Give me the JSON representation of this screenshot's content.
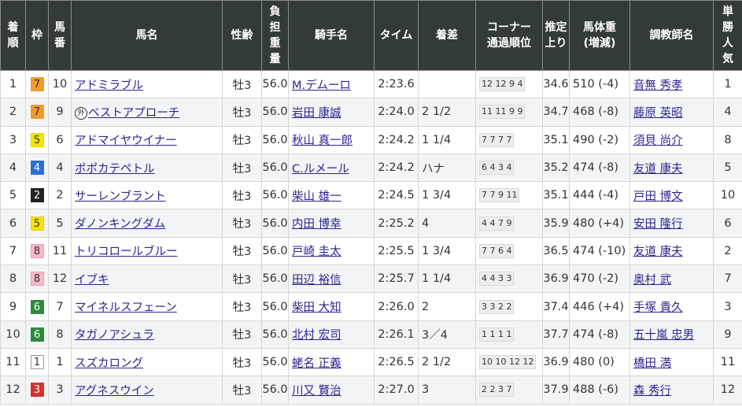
{
  "headers": {
    "rank": "着順",
    "waku": "枠",
    "umaban": "馬番",
    "horse": "馬名",
    "sexage": "性齢",
    "weight": "負担重量",
    "jockey": "騎手名",
    "time": "タイム",
    "margin": "着差",
    "corner": "コーナー\n通過順位",
    "last3f": "推定上り",
    "bodyweight": "馬体重\n(増減)",
    "trainer": "調教師名",
    "popularity": "単勝人気"
  },
  "waku_colors": {
    "1": {
      "bg": "#ffffff",
      "fg": "#333333",
      "border": "#999999"
    },
    "2": {
      "bg": "#222222",
      "fg": "#ffffff",
      "border": "#222222"
    },
    "3": {
      "bg": "#d7322d",
      "fg": "#ffffff",
      "border": "#d7322d"
    },
    "4": {
      "bg": "#2a6fd6",
      "fg": "#ffffff",
      "border": "#2a6fd6"
    },
    "5": {
      "bg": "#f5e400",
      "fg": "#333333",
      "border": "#e5d400"
    },
    "6": {
      "bg": "#2f8a3e",
      "fg": "#ffffff",
      "border": "#2f8a3e"
    },
    "7": {
      "bg": "#f29a2e",
      "fg": "#333333",
      "border": "#f29a2e"
    },
    "8": {
      "bg": "#f6b8c6",
      "fg": "#333333",
      "border": "#e8a0b2"
    }
  },
  "rows": [
    {
      "rank": "1",
      "waku": "7",
      "umaban": "10",
      "horse": "アドミラブル",
      "maru": "",
      "sexage": "牡3",
      "weight": "56.0",
      "jockey": "M.デムーロ",
      "time": "2:23.6",
      "margin": "",
      "corner": "12 12 9 4",
      "last3f": "34.6",
      "bodyweight": "510 (-4)",
      "trainer": "音無 秀孝",
      "popularity": "1"
    },
    {
      "rank": "2",
      "waku": "7",
      "umaban": "9",
      "horse": "ベストアプローチ",
      "maru": "外",
      "sexage": "牡3",
      "weight": "56.0",
      "jockey": "岩田 康誠",
      "time": "2:24.0",
      "margin": "2 1/2",
      "corner": "11 11 9 9",
      "last3f": "34.7",
      "bodyweight": "468 (-8)",
      "trainer": "藤原 英昭",
      "popularity": "4"
    },
    {
      "rank": "3",
      "waku": "5",
      "umaban": "6",
      "horse": "アドマイヤウイナー",
      "maru": "",
      "sexage": "牡3",
      "weight": "56.0",
      "jockey": "秋山 真一郎",
      "time": "2:24.2",
      "margin": "1 1/4",
      "corner": "7 7 7 7",
      "last3f": "35.1",
      "bodyweight": "490 (-2)",
      "trainer": "須貝 尚介",
      "popularity": "8"
    },
    {
      "rank": "4",
      "waku": "4",
      "umaban": "4",
      "horse": "ポポカテペトル",
      "maru": "",
      "sexage": "牡3",
      "weight": "56.0",
      "jockey": "C.ルメール",
      "time": "2:24.2",
      "margin": "ハナ",
      "corner": "6 4 3 4",
      "last3f": "35.2",
      "bodyweight": "474 (-8)",
      "trainer": "友道 康夫",
      "popularity": "5"
    },
    {
      "rank": "5",
      "waku": "2",
      "umaban": "2",
      "horse": "サーレンブラント",
      "maru": "",
      "sexage": "牡3",
      "weight": "56.0",
      "jockey": "柴山 雄一",
      "time": "2:24.5",
      "margin": "1 3/4",
      "corner": "7 7 9 11",
      "last3f": "35.1",
      "bodyweight": "444 (-4)",
      "trainer": "戸田 博文",
      "popularity": "10"
    },
    {
      "rank": "6",
      "waku": "5",
      "umaban": "5",
      "horse": "ダノンキングダム",
      "maru": "",
      "sexage": "牡3",
      "weight": "56.0",
      "jockey": "内田 博幸",
      "time": "2:25.2",
      "margin": "4",
      "corner": "4 4 7 9",
      "last3f": "35.9",
      "bodyweight": "480 (+4)",
      "trainer": "安田 隆行",
      "popularity": "6"
    },
    {
      "rank": "7",
      "waku": "8",
      "umaban": "11",
      "horse": "トリコロールブルー",
      "maru": "",
      "sexage": "牡3",
      "weight": "56.0",
      "jockey": "戸崎 圭太",
      "time": "2:25.5",
      "margin": "1 3/4",
      "corner": "7 7 6 4",
      "last3f": "36.5",
      "bodyweight": "474 (-10)",
      "trainer": "友道 康夫",
      "popularity": "2"
    },
    {
      "rank": "8",
      "waku": "8",
      "umaban": "12",
      "horse": "イブキ",
      "maru": "",
      "sexage": "牡3",
      "weight": "56.0",
      "jockey": "田辺 裕信",
      "time": "2:25.7",
      "margin": "1 1/4",
      "corner": "4 4 3 3",
      "last3f": "36.9",
      "bodyweight": "470 (-2)",
      "trainer": "奥村 武",
      "popularity": "7"
    },
    {
      "rank": "9",
      "waku": "6",
      "umaban": "7",
      "horse": "マイネルスフェーン",
      "maru": "",
      "sexage": "牡3",
      "weight": "56.0",
      "jockey": "柴田 大知",
      "time": "2:26.0",
      "margin": "2",
      "corner": "3 3 2 2",
      "last3f": "37.4",
      "bodyweight": "446 (+4)",
      "trainer": "手塚 貴久",
      "popularity": "3"
    },
    {
      "rank": "10",
      "waku": "6",
      "umaban": "8",
      "horse": "タガノアシュラ",
      "maru": "",
      "sexage": "牡3",
      "weight": "56.0",
      "jockey": "北村 宏司",
      "time": "2:26.1",
      "margin": "3／4",
      "corner": "1 1 1 1",
      "last3f": "37.7",
      "bodyweight": "474 (-8)",
      "trainer": "五十嵐 忠男",
      "popularity": "9"
    },
    {
      "rank": "11",
      "waku": "1",
      "umaban": "1",
      "horse": "スズカロング",
      "maru": "",
      "sexage": "牡3",
      "weight": "56.0",
      "jockey": "蛯名 正義",
      "time": "2:26.5",
      "margin": "2 1/2",
      "corner": "10 10 12 12",
      "last3f": "36.9",
      "bodyweight": "480 (0)",
      "trainer": "橋田 満",
      "popularity": "11"
    },
    {
      "rank": "12",
      "waku": "3",
      "umaban": "3",
      "horse": "アグネスウイン",
      "maru": "",
      "sexage": "牡3",
      "weight": "56.0",
      "jockey": "川又 賢治",
      "time": "2:27.0",
      "margin": "3",
      "corner": "2 2 3 7",
      "last3f": "37.9",
      "bodyweight": "488 (-6)",
      "trainer": "森 秀行",
      "popularity": "12"
    }
  ]
}
